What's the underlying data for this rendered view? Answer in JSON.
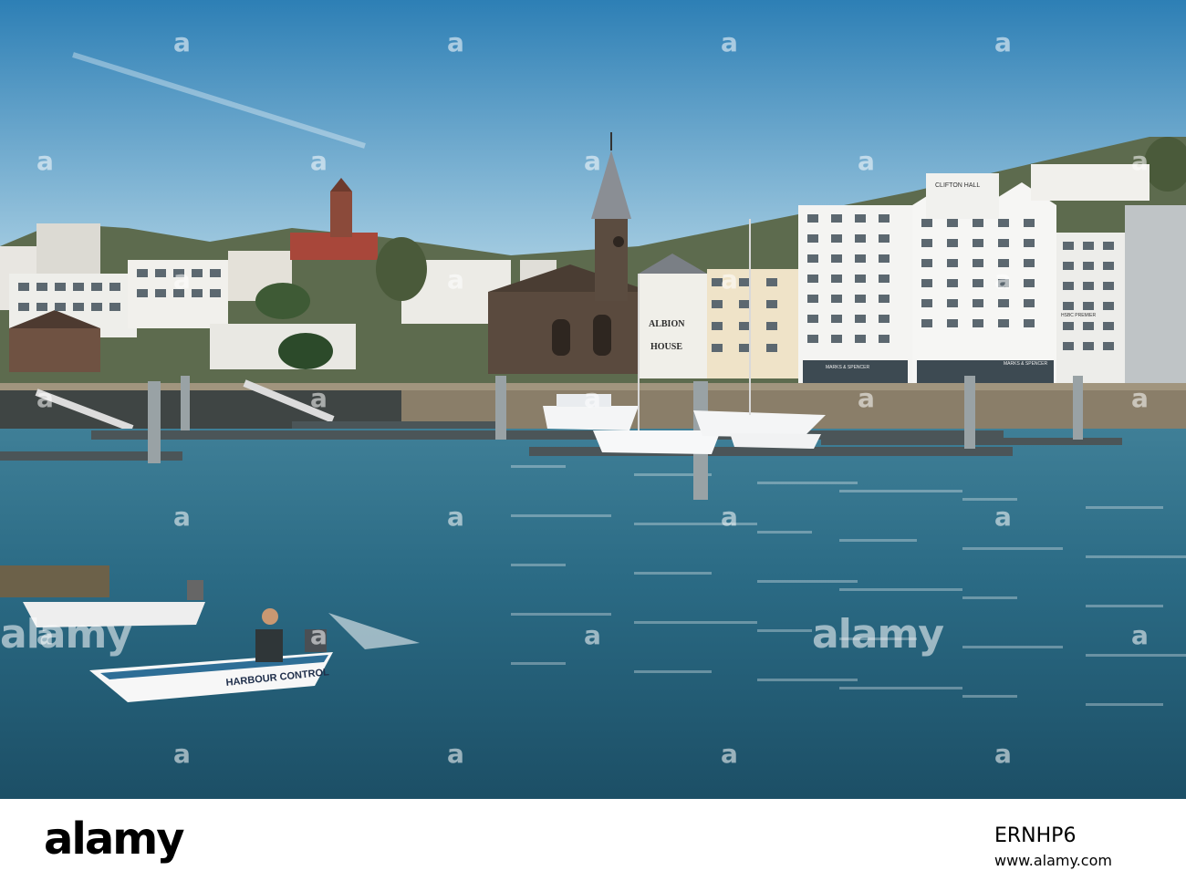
{
  "photo": {
    "signage": {
      "albion_line1": "ALBION",
      "albion_line2": "HOUSE",
      "clifton_hall": "CLIFTON HALL",
      "marks_spencer_1": "MARKS & SPENCER",
      "marks_spencer_2": "MARKS & SPENCER",
      "hsbc": "HSBC PREMIER"
    },
    "boat_text": "HARBOUR CONTROL",
    "colors": {
      "sky_top": "#2d7fb5",
      "sky_bottom": "#9ac6de",
      "water": "#2d6d86",
      "water_dark": "#1d4c61"
    }
  },
  "watermark": {
    "logo": "a",
    "center_text": "alamy"
  },
  "footer": {
    "logo": "alamy",
    "image_id": "ERNHP6",
    "url": "www.alamy.com"
  }
}
